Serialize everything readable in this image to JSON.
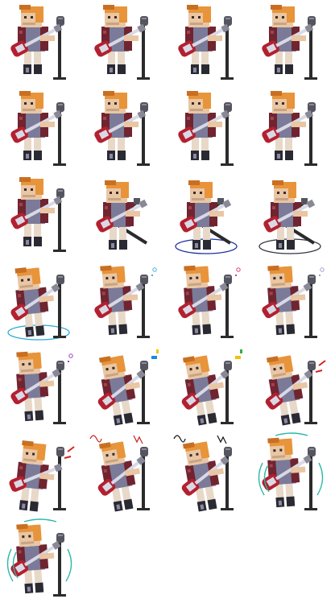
{
  "sheet": {
    "columns": 4,
    "frame_count": 25,
    "colors": {
      "hair": "#e8943a",
      "hair_dark": "#c96f22",
      "skin": "#e9c6a4",
      "skin_shade": "#c9a483",
      "jacket": "#6f2430",
      "jacket_light": "#a0424f",
      "shirt": "#7b7b99",
      "pants": "#e7d8c8",
      "boots": "#2a2a33",
      "guitar_body": "#b3202f",
      "guitar_white": "#d9d9e6",
      "mic_stand": "#2b2b2b",
      "mic_head": "#555560"
    },
    "frames": [
      {
        "pose": "idle",
        "fx": "none"
      },
      {
        "pose": "idle",
        "fx": "none"
      },
      {
        "pose": "idle",
        "fx": "none"
      },
      {
        "pose": "idle",
        "fx": "none"
      },
      {
        "pose": "idle",
        "fx": "none"
      },
      {
        "pose": "idle",
        "fx": "none"
      },
      {
        "pose": "idle",
        "fx": "none"
      },
      {
        "pose": "idle",
        "fx": "none"
      },
      {
        "pose": "idle",
        "fx": "none"
      },
      {
        "pose": "swing",
        "fx": "none"
      },
      {
        "pose": "swing",
        "fx": "ring",
        "fx_color": "#1f2fa0"
      },
      {
        "pose": "swing",
        "fx": "ring",
        "fx_color": "#333344"
      },
      {
        "pose": "lean",
        "fx": "ring",
        "fx_color": "#2aa8d8"
      },
      {
        "pose": "play",
        "fx": "spark",
        "fx_color": "#4ab0d8"
      },
      {
        "pose": "play",
        "fx": "spark",
        "fx_color": "#e0407a"
      },
      {
        "pose": "play",
        "fx": "spark",
        "fx_color": "#a0a0c8"
      },
      {
        "pose": "play",
        "fx": "spark",
        "fx_color": "#9a40c0"
      },
      {
        "pose": "jump",
        "fx": "notes",
        "fx_color": "#1e88e5",
        "fx_color2": "#f2c200"
      },
      {
        "pose": "jump",
        "fx": "notes",
        "fx_color": "#f2c200",
        "fx_color2": "#30b040"
      },
      {
        "pose": "jump",
        "fx": "dash",
        "fx_color": "#d82020"
      },
      {
        "pose": "kick",
        "fx": "dash",
        "fx_color": "#d82020"
      },
      {
        "pose": "jump",
        "fx": "squiggle",
        "fx_color": "#c82020"
      },
      {
        "pose": "jump",
        "fx": "squiggle",
        "fx_color": "#111111"
      },
      {
        "pose": "play",
        "fx": "arcs",
        "fx_color": "#2ab8a8"
      },
      {
        "pose": "play",
        "fx": "arcs",
        "fx_color": "#2ab8a8"
      }
    ]
  }
}
